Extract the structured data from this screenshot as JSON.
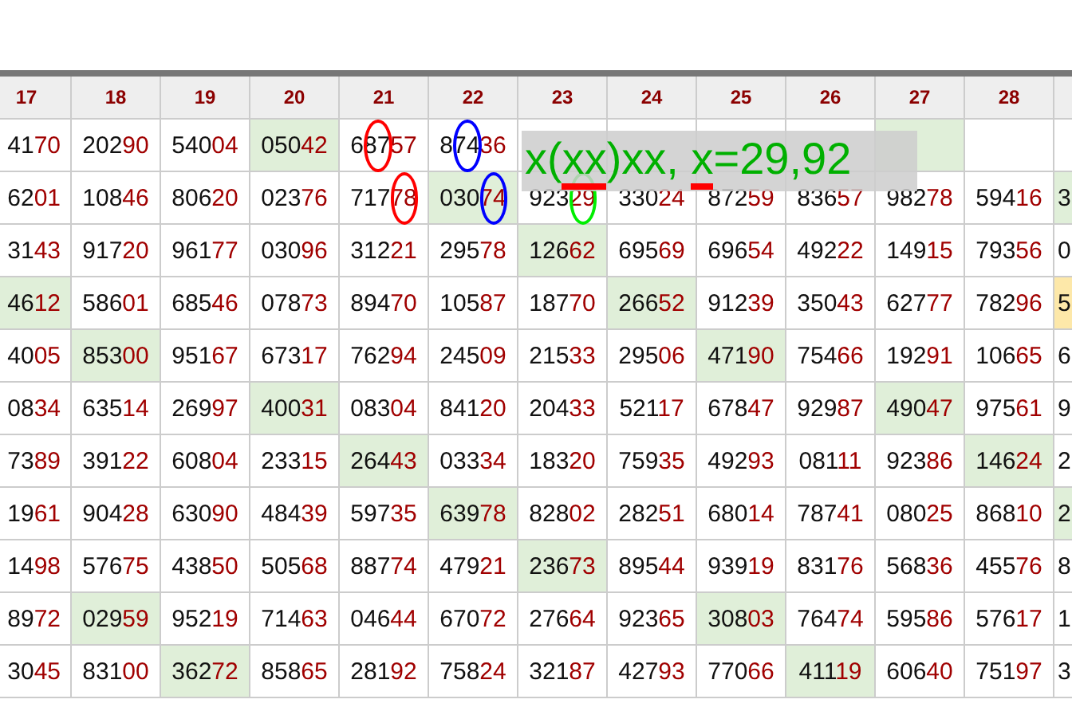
{
  "columns": [
    {
      "label": "17",
      "kind": "cut-left"
    },
    {
      "label": "18",
      "kind": "full"
    },
    {
      "label": "19",
      "kind": "full"
    },
    {
      "label": "20",
      "kind": "full"
    },
    {
      "label": "21",
      "kind": "full"
    },
    {
      "label": "22",
      "kind": "full"
    },
    {
      "label": "23",
      "kind": "full"
    },
    {
      "label": "24",
      "kind": "full"
    },
    {
      "label": "25",
      "kind": "full"
    },
    {
      "label": "26",
      "kind": "full"
    },
    {
      "label": "27",
      "kind": "full"
    },
    {
      "label": "28",
      "kind": "full"
    },
    {
      "kind": "sliver"
    }
  ],
  "rows": [
    {
      "cells": [
        {
          "text": "4170"
        },
        {
          "text": "20290"
        },
        {
          "text": "54004"
        },
        {
          "text": "05042",
          "color": "#e0efd9"
        },
        {
          "segments": [
            {
              "text": "6",
              "kind": "plain"
            },
            {
              "text": "87",
              "kind": "circled",
              "color": "#ff0000"
            },
            {
              "text": "57",
              "kind": "tail"
            }
          ]
        },
        {
          "segments": [
            {
              "text": "8",
              "kind": "plain"
            },
            {
              "text": "74",
              "kind": "circled",
              "color": "#0000ff"
            },
            {
              "text": "36",
              "kind": "tail"
            }
          ]
        },
        {},
        {},
        {},
        {},
        {
          "color": "#e0efd9"
        },
        {},
        {}
      ]
    },
    {
      "cells": [
        {
          "text": "6201"
        },
        {
          "text": "10846"
        },
        {
          "text": "80620"
        },
        {
          "text": "02376"
        },
        {
          "segments": [
            {
              "text": "717",
              "kind": "plain"
            },
            {
              "text": "78",
              "kind": "circled-tail",
              "color": "#ff0000"
            }
          ]
        },
        {
          "color": "#e0efd9",
          "segments": [
            {
              "text": "030",
              "kind": "plain"
            },
            {
              "text": "74",
              "kind": "circled-tail",
              "color": "#0000ff"
            }
          ]
        },
        {
          "segments": [
            {
              "text": "923",
              "kind": "plain"
            },
            {
              "text": "29",
              "kind": "circled-tail",
              "color": "#00ee00"
            }
          ]
        },
        {
          "text": "33024"
        },
        {
          "text": "87259"
        },
        {
          "text": "83657"
        },
        {
          "text": "98278"
        },
        {
          "text": "59416"
        },
        {
          "text": "3",
          "color": "#e0efd9"
        }
      ]
    },
    {
      "cells": [
        {
          "text": "3143"
        },
        {
          "text": "91720"
        },
        {
          "text": "96177"
        },
        {
          "text": "03096"
        },
        {
          "text": "31221"
        },
        {
          "text": "29578"
        },
        {
          "text": "12662",
          "color": "#e0efd9"
        },
        {
          "text": "69569"
        },
        {
          "text": "69654"
        },
        {
          "text": "49222"
        },
        {
          "text": "14915"
        },
        {
          "text": "79356"
        },
        {
          "text": "0"
        }
      ]
    },
    {
      "cells": [
        {
          "text": "4612",
          "color": "#e0efd9"
        },
        {
          "text": "58601"
        },
        {
          "text": "68546"
        },
        {
          "text": "07873"
        },
        {
          "text": "89470"
        },
        {
          "text": "10587"
        },
        {
          "text": "18770"
        },
        {
          "text": "26652",
          "color": "#e0efd9"
        },
        {
          "text": "91239"
        },
        {
          "text": "35043"
        },
        {
          "text": "62777"
        },
        {
          "text": "78296"
        },
        {
          "text": "5",
          "color": "#fde8a9"
        }
      ]
    },
    {
      "cells": [
        {
          "text": "4005"
        },
        {
          "text": "85300",
          "color": "#e0efd9"
        },
        {
          "text": "95167"
        },
        {
          "text": "67317"
        },
        {
          "text": "76294"
        },
        {
          "text": "24509"
        },
        {
          "text": "21533"
        },
        {
          "text": "29506"
        },
        {
          "text": "47190",
          "color": "#e0efd9"
        },
        {
          "text": "75466"
        },
        {
          "text": "19291"
        },
        {
          "text": "10665"
        },
        {
          "text": "6"
        }
      ]
    },
    {
      "cells": [
        {
          "text": "0834"
        },
        {
          "text": "63514"
        },
        {
          "text": "26997"
        },
        {
          "text": "40031",
          "color": "#e0efd9"
        },
        {
          "text": "08304"
        },
        {
          "text": "84120"
        },
        {
          "text": "20433"
        },
        {
          "text": "52117"
        },
        {
          "text": "67847"
        },
        {
          "text": "92987"
        },
        {
          "text": "49047",
          "color": "#e0efd9"
        },
        {
          "text": "97561"
        },
        {
          "text": "9"
        }
      ]
    },
    {
      "cells": [
        {
          "text": "7389"
        },
        {
          "text": "39122"
        },
        {
          "text": "60804"
        },
        {
          "text": "23315"
        },
        {
          "text": "26443",
          "color": "#e0efd9"
        },
        {
          "text": "03334"
        },
        {
          "text": "18320"
        },
        {
          "text": "75935"
        },
        {
          "text": "49293"
        },
        {
          "text": "08111"
        },
        {
          "text": "92386"
        },
        {
          "text": "14624",
          "color": "#e0efd9"
        },
        {
          "text": "2"
        }
      ]
    },
    {
      "cells": [
        {
          "text": "1961"
        },
        {
          "text": "90428"
        },
        {
          "text": "63090"
        },
        {
          "text": "48439"
        },
        {
          "text": "59735"
        },
        {
          "text": "63978",
          "color": "#e0efd9"
        },
        {
          "text": "82802"
        },
        {
          "text": "28251"
        },
        {
          "text": "68014"
        },
        {
          "text": "78741"
        },
        {
          "text": "08025"
        },
        {
          "text": "86810"
        },
        {
          "text": "2",
          "color": "#e0efd9"
        }
      ]
    },
    {
      "cells": [
        {
          "text": "1498"
        },
        {
          "text": "57675"
        },
        {
          "text": "43850"
        },
        {
          "text": "50568"
        },
        {
          "text": "88774"
        },
        {
          "text": "47921"
        },
        {
          "text": "23673",
          "color": "#e0efd9"
        },
        {
          "text": "89544"
        },
        {
          "text": "93919"
        },
        {
          "text": "83176"
        },
        {
          "text": "56836"
        },
        {
          "text": "45576"
        },
        {
          "text": "8"
        }
      ]
    },
    {
      "cells": [
        {
          "text": "8972"
        },
        {
          "text": "02959",
          "color": "#e0efd9"
        },
        {
          "text": "95219"
        },
        {
          "text": "71463"
        },
        {
          "text": "04644"
        },
        {
          "text": "67072"
        },
        {
          "text": "27664"
        },
        {
          "text": "92365"
        },
        {
          "text": "30803",
          "color": "#e0efd9"
        },
        {
          "text": "76474"
        },
        {
          "text": "59586"
        },
        {
          "text": "57617"
        },
        {
          "text": "1"
        }
      ]
    },
    {
      "cells": [
        {
          "text": "3045"
        },
        {
          "text": "83100"
        },
        {
          "text": "36272",
          "color": "#e0efd9"
        },
        {
          "text": "85865"
        },
        {
          "text": "28192"
        },
        {
          "text": "75824"
        },
        {
          "text": "32187"
        },
        {
          "text": "42793"
        },
        {
          "text": "77066"
        },
        {
          "text": "41119",
          "color": "#e0efd9"
        },
        {
          "text": "60640"
        },
        {
          "text": "75197"
        },
        {
          "text": "3"
        }
      ]
    }
  ],
  "overlay": {
    "segments": [
      {
        "text": "x(",
        "kind": "plain"
      },
      {
        "text": "xx",
        "kind": "underlined",
        "color": "#ff0000"
      },
      {
        "text": ")xx, ",
        "kind": "plain"
      },
      {
        "text": "x",
        "kind": "underlined",
        "color": "#ff0000"
      },
      {
        "text": "=29,92",
        "kind": "plain"
      }
    ]
  }
}
